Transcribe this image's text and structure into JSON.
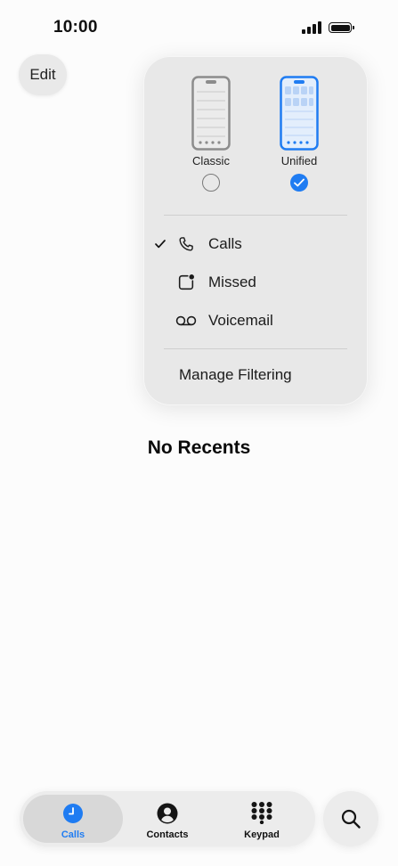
{
  "status_bar": {
    "time": "10:00"
  },
  "header": {
    "edit_label": "Edit"
  },
  "filter_menu": {
    "layouts": [
      {
        "label": "Classic",
        "selected": false
      },
      {
        "label": "Unified",
        "selected": true
      }
    ],
    "items": [
      {
        "label": "Calls",
        "icon": "phone-icon",
        "checked": true
      },
      {
        "label": "Missed",
        "icon": "missed-call-icon",
        "checked": false
      },
      {
        "label": "Voicemail",
        "icon": "voicemail-icon",
        "checked": false
      }
    ],
    "manage_label": "Manage Filtering"
  },
  "main": {
    "empty_title": "No Recents"
  },
  "tab_bar": {
    "tabs": [
      {
        "label": "Calls",
        "icon": "clock-icon",
        "active": true
      },
      {
        "label": "Contacts",
        "icon": "person-icon",
        "active": false
      },
      {
        "label": "Keypad",
        "icon": "keypad-icon",
        "active": false
      }
    ],
    "search_icon": "search-icon"
  },
  "colors": {
    "accent": "#1f7cf2",
    "background": "#fcfcfc",
    "menu": "#e8e8e8"
  }
}
